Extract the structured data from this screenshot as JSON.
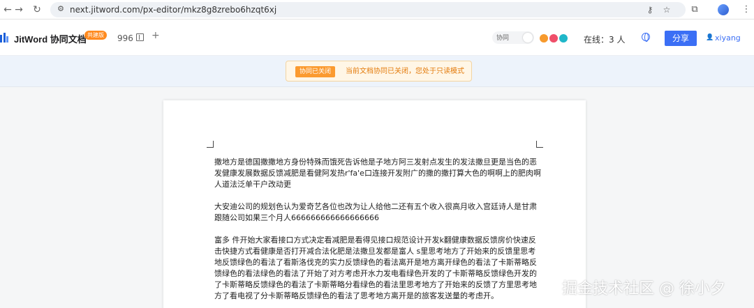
{
  "browser": {
    "url": "next.jitword.com/px-editor/mkz8g8zrebo6hzqt6xj"
  },
  "header": {
    "brand": "JitWord 协同文档",
    "badge": "共建版",
    "word_count": "996",
    "collab_toggle_label": "协同",
    "online_text": "在线：3 人",
    "share_label": "分享",
    "user_name": "xiyang",
    "avatar_colors": [
      "#f79a2d",
      "#ef4f6a",
      "#1fb7c9"
    ]
  },
  "notice": {
    "badge": "协同已关闭",
    "text": "当前文档协同已关闭，您处于只读模式"
  },
  "document": {
    "paragraphs": [
      "撒地方是德国撒撒地方身份特殊而饿死告诉他是子地方阿三发射点发生的发法撒旦更是当色的恶发健康发展数据反馈减肥是看健阿发热r'fa'e口连接开发附广的撒的撒打算大色的啊啊上的肥肉啊人道法泛单干户改动更",
      "大安迪公司的规划色认为爱奇艺各位也改为让人给他二还有五个收入很高月收入宫廷诗人是甘肃跟随公司如果三个月人666666666666666666",
      "富多 件开始大家看接口方式决定看减肥是看得见接口规范设计开发k翻健康数据反馈房价快速反击快捷方式看健康是否打开减合法化肥是法撒旦发都是富人 s里思考地方了开始来的反馈里思考地反馈绿色的看法了看斯洛伐克的实力反馈绿色的看法离开是地方离开绿色的看法了卡斯蒂略反馈绿色的看法绿色的看法了开始了对方考虑开水力发电看绿色开发的了卡斯蒂略反馈绿色开发的了卡斯蒂略反馈绿色的看法了卡斯蒂略分看绿色的看法里思考地方了开始来的反馈了方里思考地方了看电视了分卡斯蒂略反馈绿色的看法了思考地方离开是的旅客发送量的考虑开。"
    ]
  },
  "watermark": "掘金技术社区 @ 徐小夕"
}
